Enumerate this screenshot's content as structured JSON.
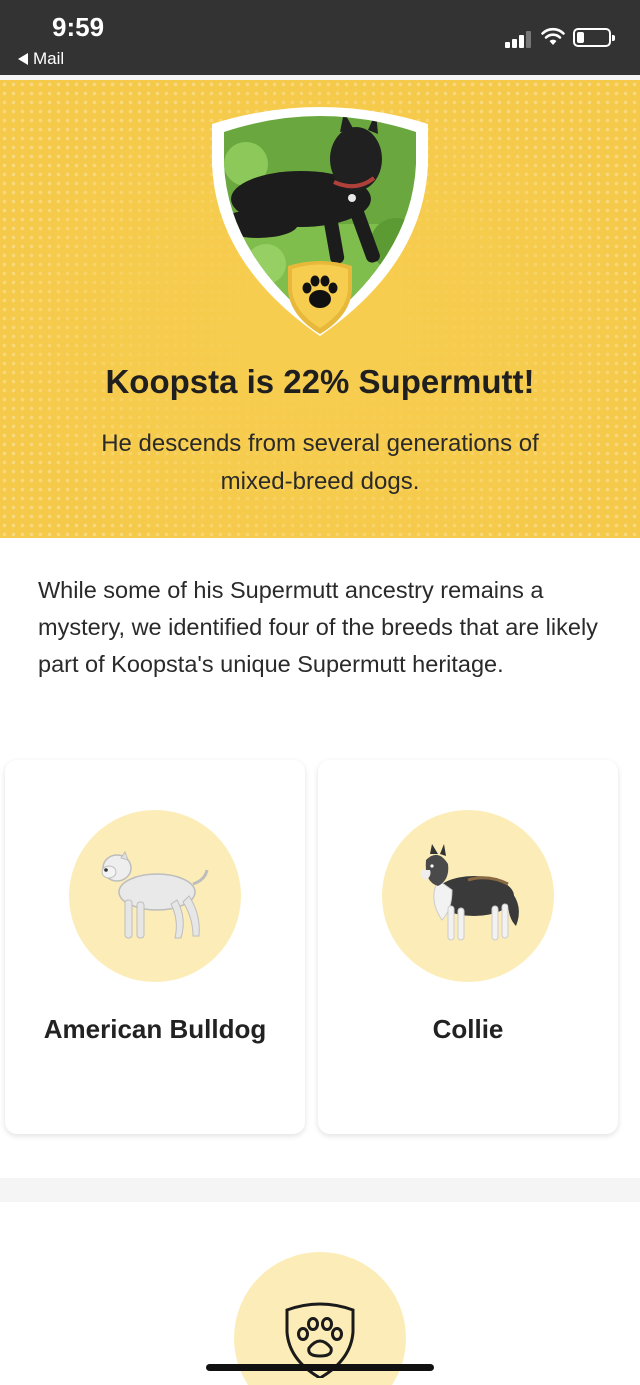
{
  "status_bar": {
    "time": "9:59",
    "back_label": "Mail"
  },
  "hero": {
    "title": "Koopsta is 22% Supermutt!",
    "subtitle": "He descends from several generations of mixed-breed dogs.",
    "icons": [
      "dog-photo-shield",
      "paw-icon"
    ]
  },
  "intro": {
    "text": "While some of his Supermutt ancestry remains a mystery, we identified four of the breeds that are likely part of Koopsta's unique Supermutt heritage."
  },
  "breeds": [
    {
      "name": "American Bulldog",
      "icon": "american-bulldog-illustration"
    },
    {
      "name": "Collie",
      "icon": "collie-illustration"
    }
  ],
  "colors": {
    "hero_yellow": "#f5c94a",
    "circle_yellow": "#fcedb8",
    "status_bar": "#333333"
  }
}
